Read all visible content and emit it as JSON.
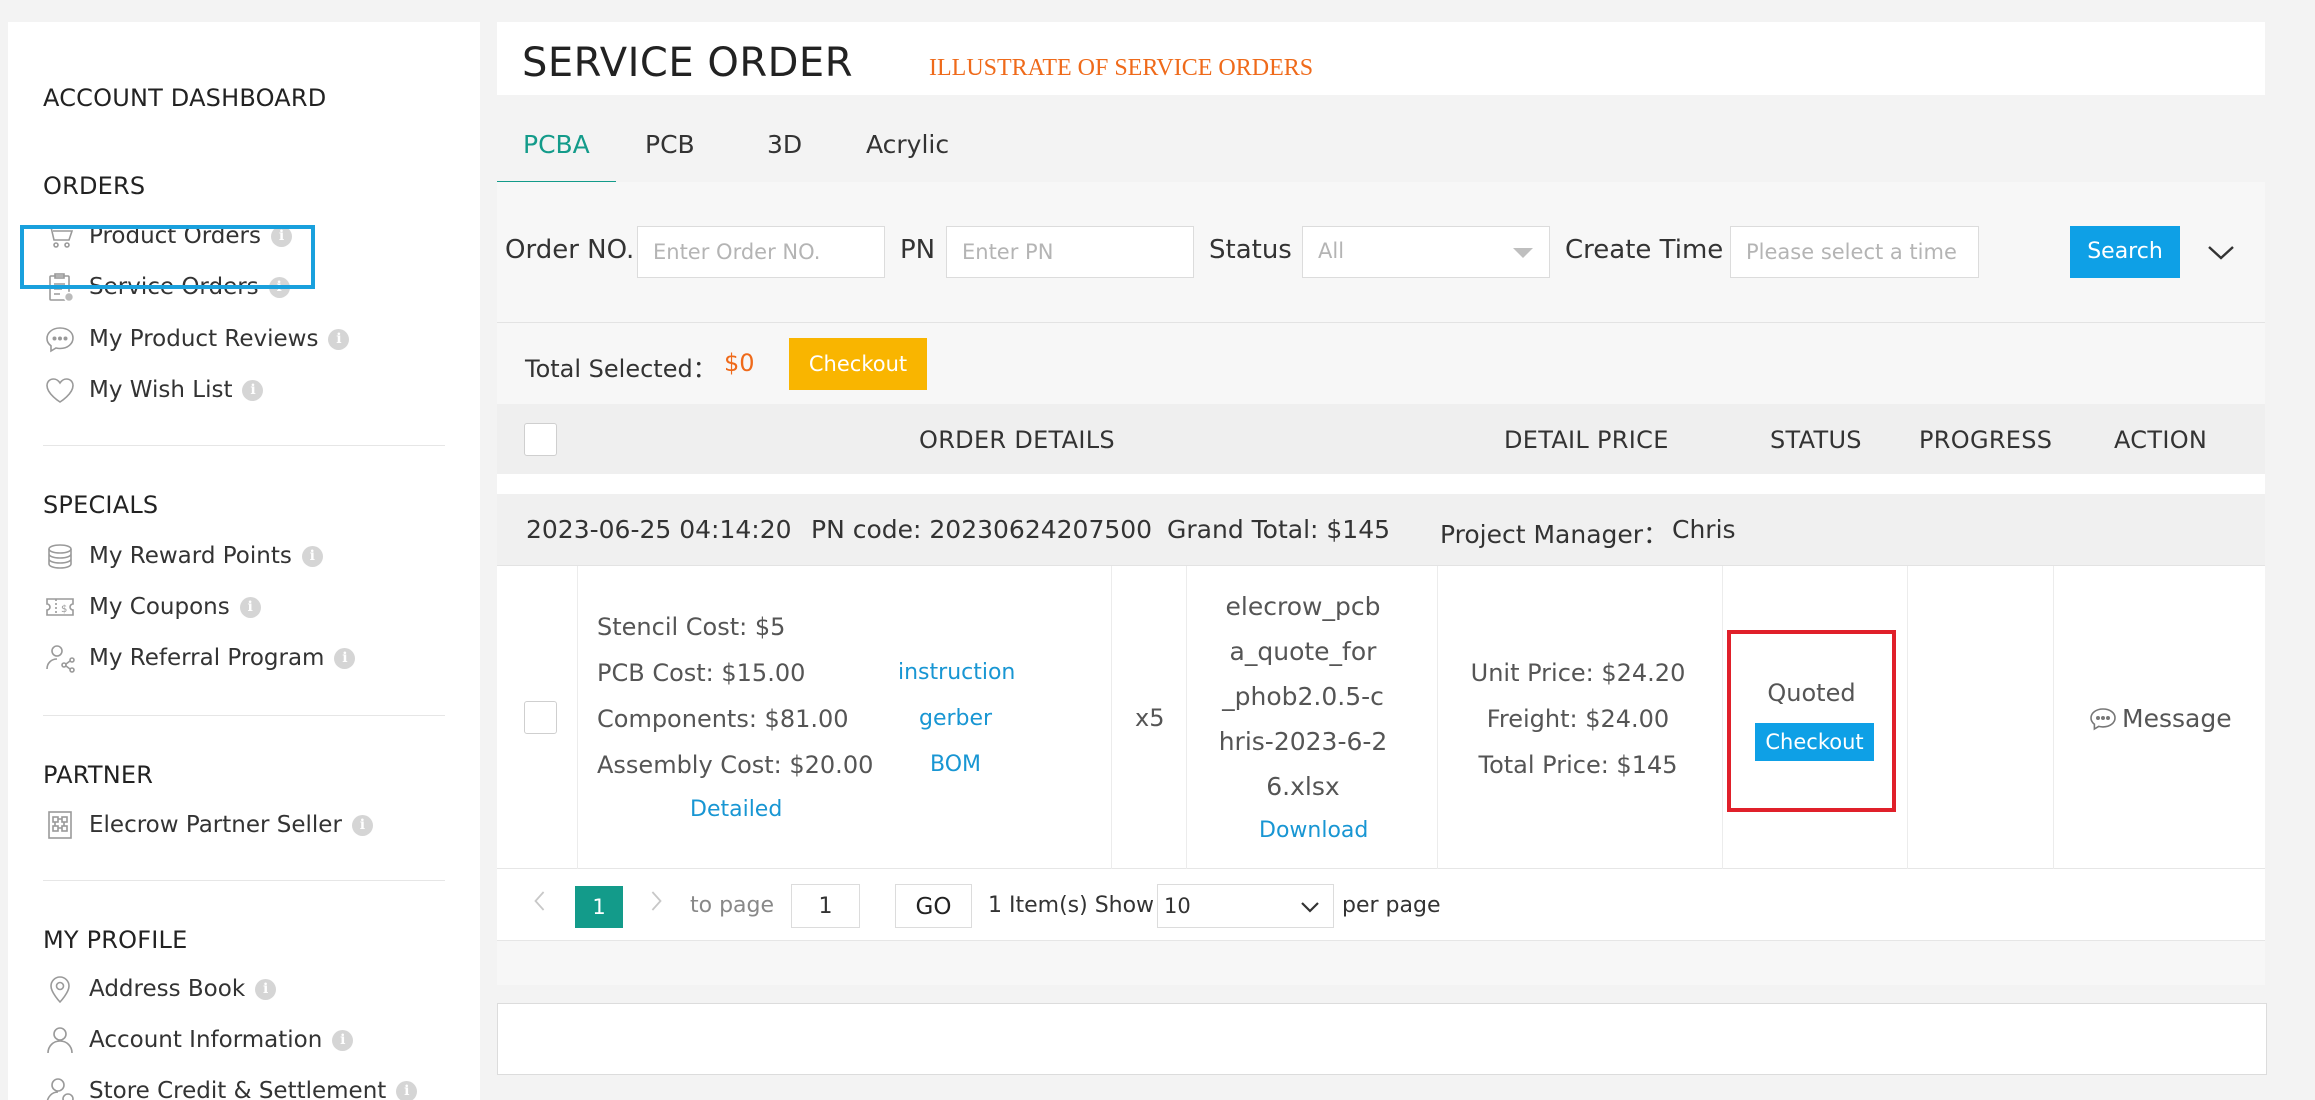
{
  "sidebar": {
    "account_title": "ACCOUNT DASHBOARD",
    "sections": [
      {
        "title": "ORDERS",
        "items": [
          {
            "label": "Product Orders",
            "icon": "cart-icon"
          },
          {
            "label": "Service Orders",
            "icon": "clipboard-icon"
          },
          {
            "label": "My Product Reviews",
            "icon": "chat-bubble-icon"
          },
          {
            "label": "My Wish List",
            "icon": "heart-icon"
          }
        ]
      },
      {
        "title": "SPECIALS",
        "items": [
          {
            "label": "My Reward Points",
            "icon": "coins-icon"
          },
          {
            "label": "My Coupons",
            "icon": "coupon-icon"
          },
          {
            "label": "My Referral Program",
            "icon": "referral-icon"
          }
        ]
      },
      {
        "title": "PARTNER",
        "items": [
          {
            "label": "Elecrow Partner Seller",
            "icon": "partner-icon"
          }
        ]
      },
      {
        "title": "MY PROFILE",
        "items": [
          {
            "label": "Address Book",
            "icon": "location-pin-icon"
          },
          {
            "label": "Account Information",
            "icon": "user-icon"
          },
          {
            "label": "Store Credit & Settlement",
            "icon": "user-credit-icon"
          }
        ]
      }
    ],
    "info_glyph": "i"
  },
  "header": {
    "title": "SERVICE ORDER",
    "annotation": "ILLUSTRATE OF SERVICE ORDERS",
    "annotation_color": "#ef6a1a"
  },
  "tabs": [
    "PCBA",
    "PCB",
    "3D",
    "Acrylic"
  ],
  "active_tab": "PCBA",
  "filters": {
    "order_no_label": "Order NO.",
    "order_no_placeholder": "Enter Order NO.",
    "pn_label": "PN",
    "pn_placeholder": "Enter PN",
    "status_label": "Status",
    "status_value": "All",
    "create_time_label": "Create Time",
    "create_time_placeholder": "Please select a time",
    "search_label": "Search"
  },
  "selection": {
    "total_label": "Total Selected：",
    "total_value": "$0",
    "checkout_label": "Checkout"
  },
  "table_headers": [
    "ORDER DETAILS",
    "DETAIL PRICE",
    "STATUS",
    "PROGRESS",
    "ACTION"
  ],
  "order": {
    "date": "2023-06-25 04:14:20",
    "pn_code": "PN code: 20230624207500",
    "grand_total": "Grand Total: $145",
    "project_manager_label": "Project Manager：",
    "project_manager": "Chris",
    "costs": [
      "Stencil Cost: $5",
      "PCB Cost: $15.00",
      "Components: $81.00",
      "Assembly Cost: $20.00"
    ],
    "detailed_link": "Detailed",
    "doc_links": [
      "instruction",
      "gerber",
      "BOM"
    ],
    "quantity": "x5",
    "file_name_lines": [
      "elecrow_pcb",
      "a_quote_for",
      "_phob2.0.5-c",
      "hris-2023-6-2",
      "6.xlsx"
    ],
    "download_link": "Download",
    "prices": [
      "Unit Price: $24.20",
      "Freight: $24.00",
      "Total Price: $145"
    ],
    "status": "Quoted",
    "status_checkout": "Checkout",
    "action": "Message"
  },
  "pagination": {
    "current_page": "1",
    "to_page_label": "to page",
    "page_input": "1",
    "go_label": "GO",
    "items_show": "1 Item(s) Show",
    "page_size": "10",
    "per_page_label": "per page"
  },
  "colors": {
    "teal": "#139b8a",
    "blue_button": "#0ea0e6",
    "yellow_button": "#f9b500",
    "highlight_blue": "#19a0dd",
    "highlight_red": "#e0202a"
  }
}
